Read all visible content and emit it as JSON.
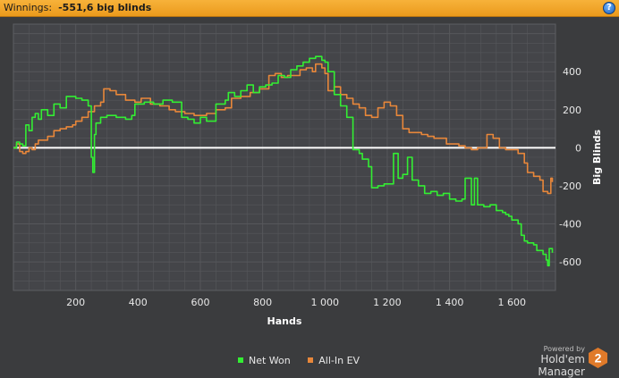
{
  "header": {
    "label": "Winnings:",
    "value": "-551,6 big blinds",
    "help_glyph": "?",
    "help_icon": "help-icon"
  },
  "branding": {
    "powered_by": "Powered by",
    "product": "Hold'em Manager",
    "logo_number": "2",
    "logo_color": "#e07a2a"
  },
  "colors": {
    "background": "#3b3c3e",
    "plot_background": "#444549",
    "grid": "#56575b",
    "zero_line": "#ffffff",
    "net_won": "#33ee33",
    "all_in_ev": "#e8873a"
  },
  "chart_data": {
    "type": "line",
    "xlabel": "Hands",
    "ylabel": "Big Blinds",
    "xlim": [
      0,
      1740
    ],
    "ylim": [
      -750,
      650
    ],
    "x_ticks": [
      {
        "value": 200,
        "label": "200"
      },
      {
        "value": 400,
        "label": "400"
      },
      {
        "value": 600,
        "label": "600"
      },
      {
        "value": 800,
        "label": "800"
      },
      {
        "value": 1000,
        "label": "1 000"
      },
      {
        "value": 1200,
        "label": "1 200"
      },
      {
        "value": 1400,
        "label": "1 400"
      },
      {
        "value": 1600,
        "label": "1 600"
      }
    ],
    "y_ticks": [
      {
        "value": 400,
        "label": "400"
      },
      {
        "value": 200,
        "label": "200"
      },
      {
        "value": 0,
        "label": "0"
      },
      {
        "value": -200,
        "label": "-200"
      },
      {
        "value": -400,
        "label": "-400"
      },
      {
        "value": -600,
        "label": "-600"
      }
    ],
    "grid": true,
    "legend_position": "bottom",
    "series": [
      {
        "name": "Net Won",
        "color": "#33ee33",
        "points": [
          [
            0,
            0
          ],
          [
            10,
            30
          ],
          [
            20,
            20
          ],
          [
            30,
            10
          ],
          [
            40,
            120
          ],
          [
            50,
            90
          ],
          [
            60,
            160
          ],
          [
            70,
            180
          ],
          [
            80,
            150
          ],
          [
            90,
            200
          ],
          [
            110,
            170
          ],
          [
            130,
            230
          ],
          [
            150,
            210
          ],
          [
            170,
            270
          ],
          [
            200,
            260
          ],
          [
            220,
            250
          ],
          [
            240,
            220
          ],
          [
            250,
            -50
          ],
          [
            255,
            -130
          ],
          [
            260,
            70
          ],
          [
            265,
            130
          ],
          [
            280,
            160
          ],
          [
            300,
            170
          ],
          [
            330,
            160
          ],
          [
            360,
            150
          ],
          [
            380,
            170
          ],
          [
            390,
            230
          ],
          [
            420,
            240
          ],
          [
            450,
            230
          ],
          [
            480,
            250
          ],
          [
            510,
            240
          ],
          [
            540,
            160
          ],
          [
            560,
            150
          ],
          [
            580,
            130
          ],
          [
            600,
            160
          ],
          [
            620,
            140
          ],
          [
            650,
            230
          ],
          [
            680,
            250
          ],
          [
            690,
            290
          ],
          [
            710,
            270
          ],
          [
            730,
            300
          ],
          [
            750,
            330
          ],
          [
            770,
            290
          ],
          [
            790,
            320
          ],
          [
            810,
            330
          ],
          [
            830,
            340
          ],
          [
            850,
            380
          ],
          [
            870,
            370
          ],
          [
            890,
            410
          ],
          [
            910,
            430
          ],
          [
            930,
            450
          ],
          [
            950,
            470
          ],
          [
            970,
            480
          ],
          [
            990,
            460
          ],
          [
            1000,
            450
          ],
          [
            1010,
            400
          ],
          [
            1030,
            280
          ],
          [
            1050,
            220
          ],
          [
            1070,
            160
          ],
          [
            1090,
            -10
          ],
          [
            1110,
            -30
          ],
          [
            1120,
            -60
          ],
          [
            1140,
            -100
          ],
          [
            1150,
            -210
          ],
          [
            1170,
            -200
          ],
          [
            1190,
            -190
          ],
          [
            1210,
            -190
          ],
          [
            1220,
            -30
          ],
          [
            1235,
            -160
          ],
          [
            1250,
            -140
          ],
          [
            1265,
            -50
          ],
          [
            1280,
            -170
          ],
          [
            1300,
            -200
          ],
          [
            1320,
            -240
          ],
          [
            1340,
            -230
          ],
          [
            1360,
            -250
          ],
          [
            1380,
            -240
          ],
          [
            1400,
            -270
          ],
          [
            1420,
            -280
          ],
          [
            1440,
            -270
          ],
          [
            1450,
            -160
          ],
          [
            1470,
            -300
          ],
          [
            1480,
            -160
          ],
          [
            1490,
            -300
          ],
          [
            1510,
            -310
          ],
          [
            1530,
            -300
          ],
          [
            1550,
            -330
          ],
          [
            1570,
            -340
          ],
          [
            1580,
            -350
          ],
          [
            1590,
            -360
          ],
          [
            1600,
            -380
          ],
          [
            1620,
            -400
          ],
          [
            1630,
            -460
          ],
          [
            1640,
            -490
          ],
          [
            1650,
            -500
          ],
          [
            1670,
            -510
          ],
          [
            1680,
            -540
          ],
          [
            1700,
            -560
          ],
          [
            1710,
            -590
          ],
          [
            1715,
            -620
          ],
          [
            1720,
            -530
          ],
          [
            1730,
            -552
          ]
        ]
      },
      {
        "name": "All-In EV",
        "color": "#e8873a",
        "points": [
          [
            0,
            0
          ],
          [
            10,
            20
          ],
          [
            20,
            -20
          ],
          [
            30,
            -30
          ],
          [
            40,
            -20
          ],
          [
            50,
            0
          ],
          [
            60,
            -10
          ],
          [
            70,
            20
          ],
          [
            80,
            40
          ],
          [
            90,
            40
          ],
          [
            110,
            60
          ],
          [
            130,
            90
          ],
          [
            150,
            100
          ],
          [
            170,
            110
          ],
          [
            190,
            120
          ],
          [
            200,
            140
          ],
          [
            220,
            160
          ],
          [
            240,
            190
          ],
          [
            260,
            220
          ],
          [
            280,
            240
          ],
          [
            290,
            310
          ],
          [
            310,
            300
          ],
          [
            330,
            280
          ],
          [
            360,
            250
          ],
          [
            390,
            240
          ],
          [
            410,
            260
          ],
          [
            440,
            230
          ],
          [
            470,
            220
          ],
          [
            500,
            200
          ],
          [
            520,
            190
          ],
          [
            550,
            180
          ],
          [
            580,
            170
          ],
          [
            600,
            170
          ],
          [
            620,
            180
          ],
          [
            650,
            200
          ],
          [
            680,
            210
          ],
          [
            700,
            260
          ],
          [
            730,
            270
          ],
          [
            760,
            290
          ],
          [
            790,
            310
          ],
          [
            810,
            310
          ],
          [
            820,
            380
          ],
          [
            840,
            390
          ],
          [
            860,
            370
          ],
          [
            880,
            380
          ],
          [
            900,
            380
          ],
          [
            920,
            410
          ],
          [
            940,
            420
          ],
          [
            960,
            400
          ],
          [
            970,
            440
          ],
          [
            990,
            420
          ],
          [
            1000,
            390
          ],
          [
            1010,
            300
          ],
          [
            1030,
            320
          ],
          [
            1050,
            280
          ],
          [
            1070,
            260
          ],
          [
            1090,
            230
          ],
          [
            1110,
            210
          ],
          [
            1130,
            170
          ],
          [
            1150,
            160
          ],
          [
            1170,
            210
          ],
          [
            1190,
            240
          ],
          [
            1210,
            220
          ],
          [
            1230,
            170
          ],
          [
            1250,
            100
          ],
          [
            1270,
            80
          ],
          [
            1290,
            80
          ],
          [
            1310,
            70
          ],
          [
            1330,
            60
          ],
          [
            1350,
            50
          ],
          [
            1370,
            50
          ],
          [
            1390,
            20
          ],
          [
            1410,
            20
          ],
          [
            1430,
            10
          ],
          [
            1450,
            0
          ],
          [
            1470,
            -10
          ],
          [
            1490,
            0
          ],
          [
            1510,
            0
          ],
          [
            1520,
            70
          ],
          [
            1540,
            50
          ],
          [
            1560,
            0
          ],
          [
            1580,
            -10
          ],
          [
            1600,
            -10
          ],
          [
            1620,
            -30
          ],
          [
            1640,
            -80
          ],
          [
            1650,
            -130
          ],
          [
            1670,
            -150
          ],
          [
            1690,
            -170
          ],
          [
            1700,
            -230
          ],
          [
            1715,
            -240
          ],
          [
            1725,
            -160
          ],
          [
            1730,
            -180
          ]
        ]
      }
    ]
  }
}
